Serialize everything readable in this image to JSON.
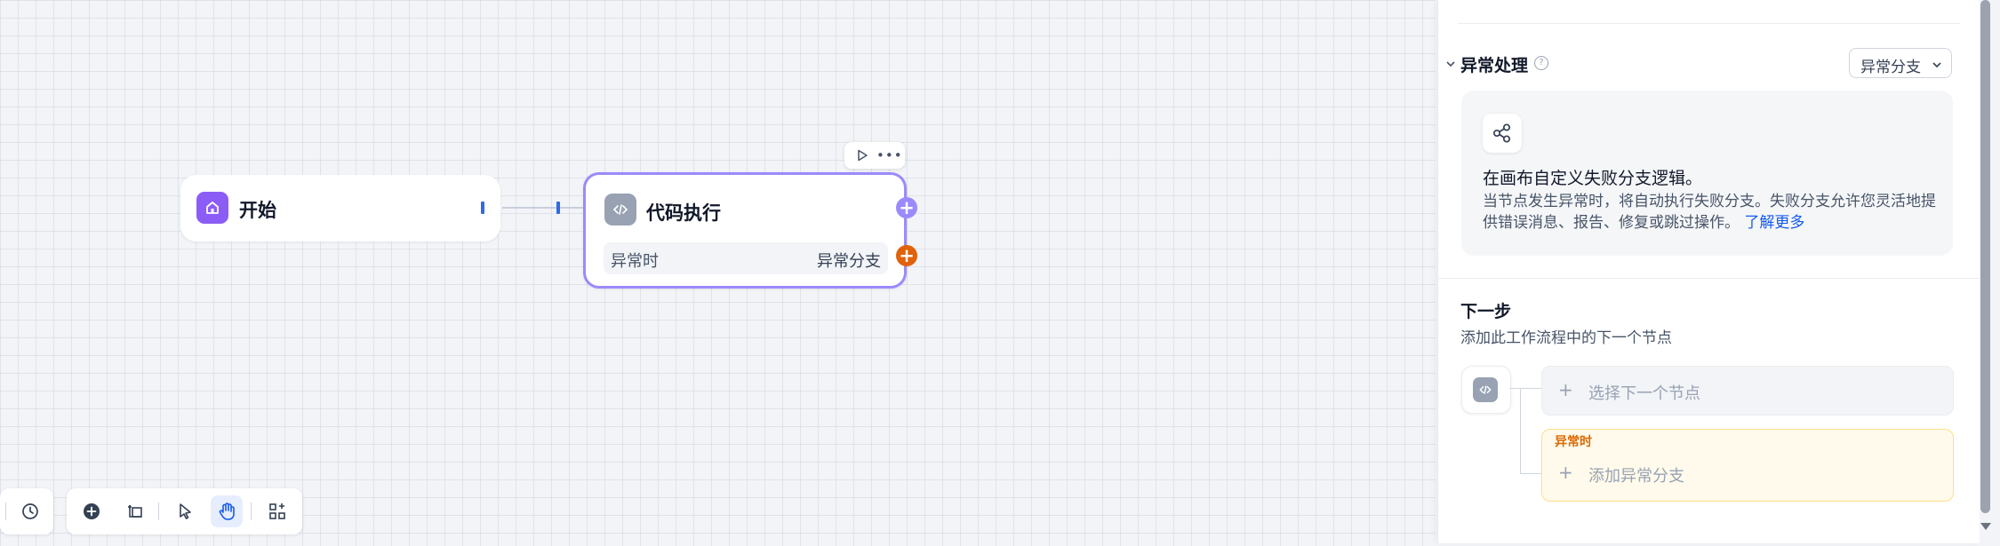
{
  "canvas": {
    "start_node": {
      "title": "开始",
      "icon": "home-icon"
    },
    "code_node": {
      "title": "代码执行",
      "icon": "code-icon",
      "exception_label": "异常时",
      "exception_value": "异常分支"
    },
    "toolbar": {
      "run_icon": "play-icon",
      "more_icon": "more-icon"
    }
  },
  "bottom_toolbar": {
    "tools": [
      "history-icon",
      "add-node-icon",
      "add-note-icon",
      "pointer-icon",
      "hand-icon",
      "organize-icon"
    ],
    "active": "hand-icon"
  },
  "panel": {
    "exception_section": {
      "title": "异常处理",
      "select_value": "异常分支",
      "info_title": "在画布自定义失败分支逻辑。",
      "info_desc": "当节点发生异常时，将自动执行失败分支。失败分支允许您灵活地提供错误消息、报告、修复或跳过操作。",
      "info_link": "了解更多"
    },
    "next_step": {
      "title": "下一步",
      "desc": "添加此工作流程中的下一个节点",
      "choose_next": "选择下一个节点",
      "fail_label": "异常时",
      "add_fail_branch": "添加异常分支"
    }
  },
  "colors": {
    "accent": "#9b8afb",
    "start_icon_bg": "#8b5cf6",
    "fail_handle": "#e0620b",
    "link": "#155aef"
  }
}
